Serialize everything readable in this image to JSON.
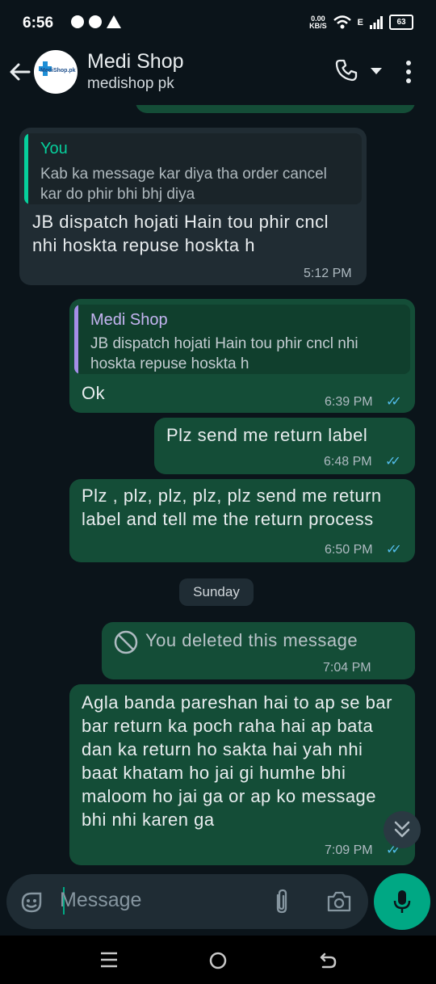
{
  "status_bar": {
    "time": "6:56",
    "speed_value": "0.00",
    "speed_unit": "KB/S",
    "network": "E",
    "battery": "63"
  },
  "header": {
    "avatar_text": "MediShop.pk",
    "title": "Medi Shop",
    "subtitle": "medishop pk",
    "icons": [
      "back-arrow-icon",
      "phone-icon",
      "dropdown-arrow-icon",
      "more-vertical-icon"
    ]
  },
  "messages": [
    {
      "direction": "incoming",
      "quote_name": "You",
      "quote_text": "Kab ka message kar diya tha order cancel kar do phir bhi bhj diya",
      "text": "JB dispatch hojati Hain tou phir cncl nhi hoskta repuse hoskta h",
      "time": "5:12 PM"
    },
    {
      "direction": "outgoing",
      "quote_name": "Medi Shop",
      "quote_text": "JB dispatch hojati Hain tou phir cncl nhi hoskta repuse hoskta h",
      "text": "Ok",
      "time": "6:39 PM"
    },
    {
      "direction": "outgoing",
      "text": "Plz send me return label",
      "time": "6:48 PM"
    },
    {
      "direction": "outgoing",
      "text": "Plz , plz, plz, plz, plz send me return label and tell me the return process",
      "time": "6:50 PM"
    },
    {
      "direction": "outgoing",
      "deleted": true,
      "text": "You deleted this message",
      "time": "7:04 PM"
    },
    {
      "direction": "outgoing",
      "text": "Agla banda pareshan hai to ap se bar bar return ka poch raha hai ap bata dan ka return ho sakta hai yah nhi baat khatam ho jai gi humhe bhi maloom ho jai ga or ap ko message  bhi nhi karen ga",
      "time": "7:09 PM"
    }
  ],
  "day_separator": "Sunday",
  "input": {
    "placeholder": "Message",
    "icons": [
      "sticker-icon",
      "attach-icon",
      "camera-icon",
      "mic-icon"
    ]
  },
  "colors": {
    "background": "#0b141a",
    "incoming_bubble": "#202c33",
    "outgoing_bubble": "#144d37",
    "accent": "#00a884",
    "read_ticks": "#53bdeb"
  }
}
